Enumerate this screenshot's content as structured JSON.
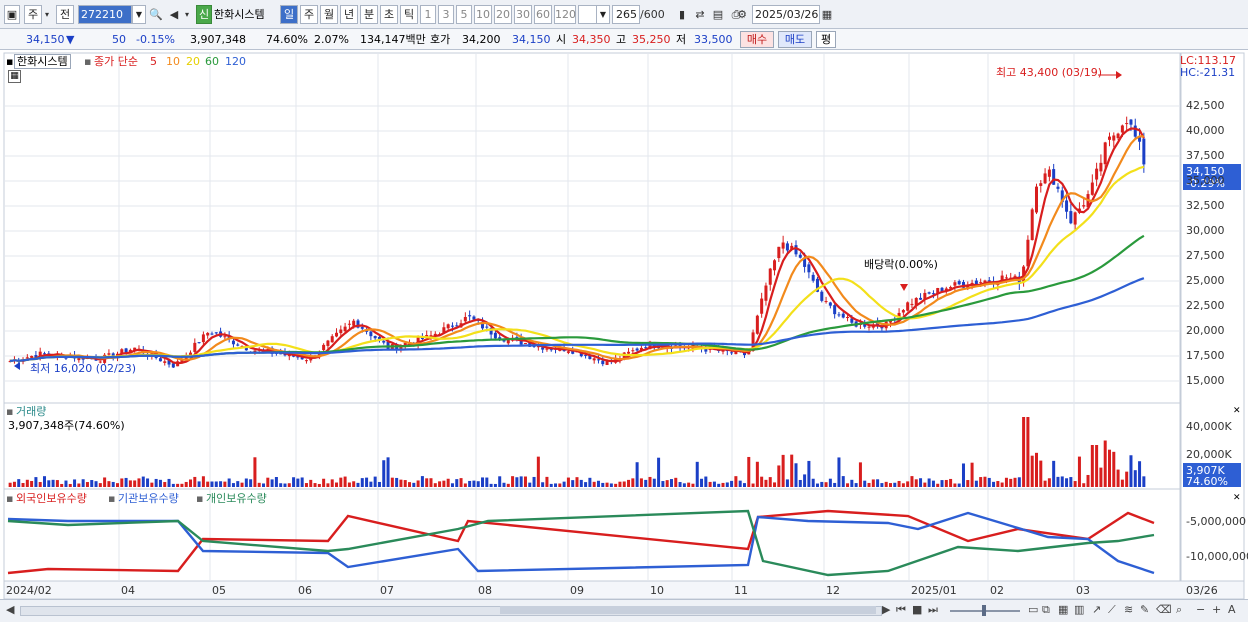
{
  "toolbar": {
    "tabs": [
      "주",
      "전"
    ],
    "code": "272210",
    "badge": "신",
    "stock_name": "한화시스템",
    "periods": [
      "일",
      "주",
      "월",
      "년",
      "분",
      "초",
      "틱"
    ],
    "active_period": "일",
    "intervals": [
      "1",
      "3",
      "5",
      "10",
      "20",
      "30",
      "60",
      "120"
    ],
    "count_value": "265",
    "count_total": "/600",
    "date": "2025/03/26"
  },
  "info": {
    "price": "34,150",
    "arrow": "▼",
    "change": "50",
    "change_pct": "-0.15%",
    "volume": "3,907,348",
    "volume_ratio": "74.60%",
    "turnover": "2.07%",
    "amount": "134,147백만",
    "quote_label": "호가",
    "quote_value": "34,200",
    "quote_value2": "34,150",
    "open_label": "시",
    "open": "34,350",
    "high_label": "고",
    "high": "35,250",
    "low_label": "저",
    "low": "33,500",
    "buy": "매수",
    "sell": "매도",
    "avg": "평"
  },
  "price_panel": {
    "name": "한화시스템",
    "indicator": "종가 단순",
    "ma_periods": [
      "5",
      "10",
      "20",
      "60",
      "120"
    ],
    "ma_colors": [
      "#d81e1e",
      "#f28a1c",
      "#f3e01a",
      "#2a9a3c",
      "#2e5fd4"
    ],
    "lc": "LC:113.17",
    "hc": "HC:-21.31",
    "current_price_tag": "34,150",
    "current_pct_tag": "-0.29%",
    "high_note": "최고 43,400 (03/19)",
    "low_note": "최저 16,020 (02/23)",
    "dividend_note": "배당락(0.00%)",
    "y_ticks": [
      "42,500",
      "40,000",
      "37,500",
      "35,000",
      "32,500",
      "30,000",
      "27,500",
      "25,000",
      "22,500",
      "20,000",
      "17,500",
      "15,000"
    ]
  },
  "volume_panel": {
    "title": "거래량",
    "value": "3,907,348주(74.60%)",
    "y_ticks": [
      "40,000K",
      "20,000K"
    ],
    "current_tag": "3,907K",
    "current_pct": "74.60%"
  },
  "holdings_panel": {
    "series": [
      "외국인보유수량",
      "기관보유수량",
      "개인보유수량"
    ],
    "colors": [
      "#d81e1e",
      "#2e5fd4",
      "#2a8a5a"
    ],
    "y_ticks": [
      "-5,000,000",
      "-10,000,000"
    ]
  },
  "x_axis": [
    "2024/02",
    "04",
    "05",
    "06",
    "07",
    "08",
    "09",
    "10",
    "11",
    "12",
    "2025/01",
    "02",
    "03",
    "03/26"
  ]
}
